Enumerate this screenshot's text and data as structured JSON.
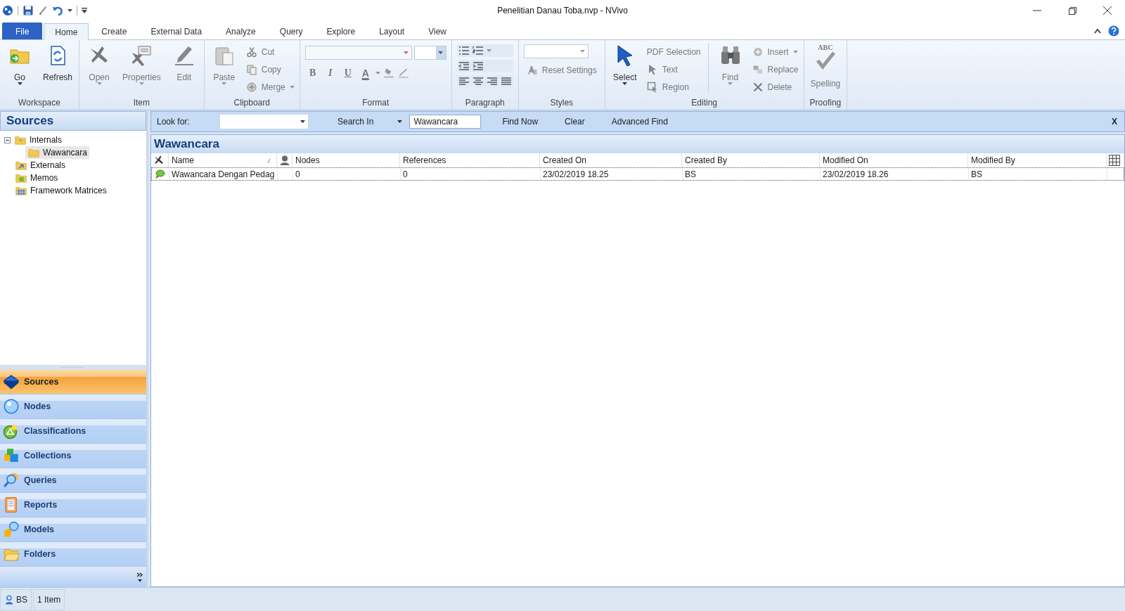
{
  "window": {
    "title": "Penelitian Danau Toba.nvp - NVivo"
  },
  "ribbon_tabs": [
    {
      "label": "File",
      "kind": "file",
      "selected": false
    },
    {
      "label": "Home",
      "kind": "tab",
      "selected": true
    },
    {
      "label": "Create",
      "kind": "tab",
      "selected": false
    },
    {
      "label": "External Data",
      "kind": "tab",
      "selected": false
    },
    {
      "label": "Analyze",
      "kind": "tab",
      "selected": false
    },
    {
      "label": "Query",
      "kind": "tab",
      "selected": false
    },
    {
      "label": "Explore",
      "kind": "tab",
      "selected": false
    },
    {
      "label": "Layout",
      "kind": "tab",
      "selected": false
    },
    {
      "label": "View",
      "kind": "tab",
      "selected": false
    }
  ],
  "ribbon_groups": [
    {
      "label": "Workspace",
      "kind": "buttons",
      "items": [
        {
          "kind": "large",
          "label": "Go",
          "dropdown": true,
          "disabled": false
        },
        {
          "kind": "large",
          "label": "Refresh",
          "dropdown": false,
          "disabled": false
        }
      ]
    },
    {
      "label": "Item",
      "kind": "buttons",
      "items": [
        {
          "kind": "large",
          "label": "Open",
          "dropdown": true,
          "disabled": true
        },
        {
          "kind": "large",
          "label": "Properties",
          "dropdown": true,
          "disabled": true
        },
        {
          "kind": "large",
          "label": "Edit",
          "dropdown": false,
          "disabled": true
        }
      ]
    },
    {
      "label": "Clipboard",
      "kind": "buttons",
      "items": [
        {
          "kind": "large",
          "label": "Paste",
          "dropdown": true,
          "disabled": true
        },
        {
          "kind": "small",
          "label": "Cut",
          "dropdown": false,
          "disabled": true
        },
        {
          "kind": "small",
          "label": "Copy",
          "dropdown": false,
          "disabled": true
        },
        {
          "kind": "small",
          "label": "Merge",
          "dropdown": true,
          "disabled": true
        }
      ]
    },
    {
      "label": "Format",
      "kind": "format",
      "items": [
        {
          "label": "B",
          "disabled": true
        },
        {
          "label": "I",
          "disabled": true
        },
        {
          "label": "U",
          "disabled": true
        },
        {
          "label": "A",
          "disabled": true
        }
      ]
    },
    {
      "label": "Paragraph",
      "kind": "paragraph"
    },
    {
      "label": "Styles",
      "kind": "styles",
      "items": [
        {
          "kind": "small",
          "label": "Reset Settings",
          "dropdown": false,
          "disabled": true
        }
      ]
    },
    {
      "label": "Editing",
      "kind": "buttons",
      "items": [
        {
          "kind": "large",
          "label": "Select",
          "dropdown": true,
          "disabled": false
        },
        {
          "kind": "small-text",
          "label": "PDF Selection",
          "dropdown": false,
          "disabled": true
        },
        {
          "kind": "small",
          "label": "Text",
          "dropdown": false,
          "disabled": true
        },
        {
          "kind": "small",
          "label": "Region",
          "dropdown": false,
          "disabled": true
        },
        {
          "kind": "large",
          "label": "Find",
          "dropdown": true,
          "disabled": true
        },
        {
          "kind": "small",
          "label": "Insert",
          "dropdown": true,
          "disabled": true
        },
        {
          "kind": "small",
          "label": "Replace",
          "dropdown": false,
          "disabled": true
        },
        {
          "kind": "small",
          "label": "Delete",
          "dropdown": false,
          "disabled": true
        }
      ]
    },
    {
      "label": "Proofing",
      "kind": "buttons",
      "items": [
        {
          "kind": "large",
          "label": "Spelling",
          "glyph": "ABC",
          "dropdown": false,
          "disabled": true
        }
      ]
    }
  ],
  "sources_panel": {
    "title": "Sources",
    "tree": [
      {
        "label": "Internals",
        "expanded": true,
        "selected": false,
        "children": [
          {
            "label": "Wawancara",
            "selected": true
          }
        ]
      },
      {
        "label": "Externals",
        "selected": false
      },
      {
        "label": "Memos",
        "selected": false
      },
      {
        "label": "Framework Matrices",
        "selected": false
      }
    ]
  },
  "navigation": [
    {
      "label": "Sources",
      "selected": true
    },
    {
      "label": "Nodes",
      "selected": false
    },
    {
      "label": "Classifications",
      "selected": false
    },
    {
      "label": "Collections",
      "selected": false
    },
    {
      "label": "Queries",
      "selected": false
    },
    {
      "label": "Reports",
      "selected": false
    },
    {
      "label": "Models",
      "selected": false
    },
    {
      "label": "Folders",
      "selected": false
    }
  ],
  "find_bar": {
    "look_for_label": "Look for:",
    "search_in": "Search In",
    "search_in_value": "Wawancara",
    "buttons": [
      "Find Now",
      "Clear",
      "Advanced Find"
    ],
    "close": "X"
  },
  "list_view": {
    "title": "Wawancara",
    "columns": [
      {
        "kind": "icon"
      },
      {
        "kind": "text",
        "label": "Name",
        "sorted": true
      },
      {
        "kind": "icon"
      },
      {
        "kind": "text",
        "label": "Nodes",
        "sorted": false
      },
      {
        "kind": "text",
        "label": "References",
        "sorted": false
      },
      {
        "kind": "text",
        "label": "Created On",
        "sorted": false
      },
      {
        "kind": "text",
        "label": "Created By",
        "sorted": false
      },
      {
        "kind": "text",
        "label": "Modified On",
        "sorted": false
      },
      {
        "kind": "text",
        "label": "Modified By",
        "sorted": false
      },
      {
        "kind": "chooser"
      }
    ],
    "rows": [
      {
        "name": "Wawancara Dengan Pedag",
        "values": [
          "0",
          "0",
          "23/02/2019 18.25",
          "BS",
          "23/02/2019 18.26",
          "BS"
        ],
        "focused": true
      }
    ]
  },
  "status_bar": {
    "user": "BS",
    "items": [
      "1 Item"
    ]
  }
}
